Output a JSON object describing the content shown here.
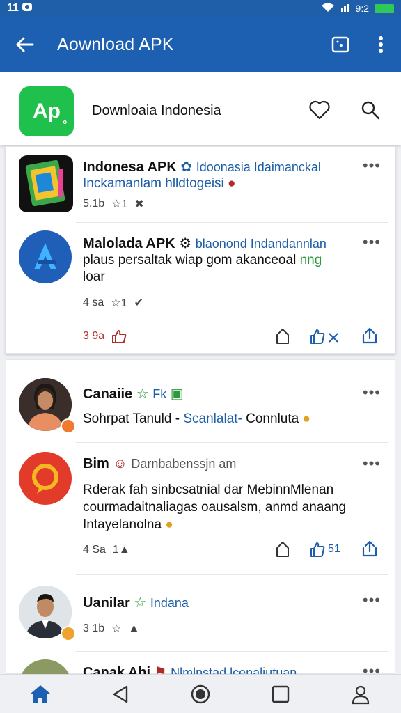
{
  "status": {
    "time": "11",
    "clock": "9:2"
  },
  "appbar": {
    "title": "Aownload APK"
  },
  "header": {
    "name": "Downloaia Indonesia",
    "logo_text": "Ap",
    "logo_small": "o"
  },
  "posts": [
    {
      "title": "Indonesa APK",
      "link": "Idoonasia Idaimanckal",
      "line2": "Inckamanlam hlldtogeisi",
      "meta": [
        "5.1b",
        "1"
      ]
    },
    {
      "title": "Malolada APK",
      "link": "blaonond Indandannlan",
      "line2a": "plaus persaltak wiap gom akanceoal",
      "line2b": "nng",
      "line3": "loar",
      "meta": [
        "4 sa",
        "1"
      ],
      "reaction": "3 9a"
    },
    {
      "title": "Canaiie",
      "link": "Fk",
      "text_a": "Sohrpat Tanuld -",
      "text_b": "Scanlalat-",
      "text_c": "Connluta"
    },
    {
      "title": "Bim",
      "link": "Darnbabenssjn am",
      "text1": "Rderak fah sinbcsatnial dar MebinnMlenan",
      "text2": "courmadaitnaliagas oausalsm, anmd anaang",
      "text3": "Intayelanolna",
      "meta": [
        "4 Sa",
        "1"
      ],
      "share_count": "51"
    },
    {
      "title": "Uanilar",
      "link": "Indana",
      "meta": [
        "3 1b"
      ]
    },
    {
      "title": "Canak Ahi",
      "link": "Nlmlnstad lcenaliutuan"
    }
  ]
}
